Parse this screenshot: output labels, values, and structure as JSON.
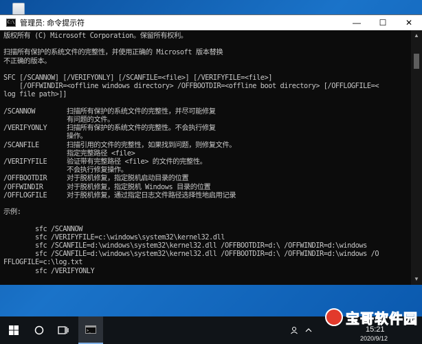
{
  "window": {
    "title": "管理员: 命令提示符",
    "icon_text": "C:\\",
    "minimize": "—",
    "maximize": "☐",
    "close": "✕"
  },
  "console": {
    "lines": [
      "版权所有 (C) Microsoft Corporation。保留所有权利。",
      "",
      "扫描所有保护的系统文件的完整性，并使用正确的 Microsoft 版本替换",
      "不正确的版本。",
      "",
      "SFC [/SCANNOW] [/VERIFYONLY] [/SCANFILE=<file>] [/VERIFYFILE=<file>]",
      "    [/OFFWINDIR=<offline windows directory> /OFFBOOTDIR=<offline boot directory> [/OFFLOGFILE=<",
      "log file path>]]",
      "",
      "/SCANNOW        扫描所有保护的系统文件的完整性，并尽可能修复",
      "                有问题的文件。",
      "/VERIFYONLY     扫描所有保护的系统文件的完整性。不会执行修复",
      "                操作。",
      "/SCANFILE       扫描引用的文件的完整性，如果找到问题，则修复文件。",
      "                指定完整路径 <file>",
      "/VERIFYFILE     验证带有完整路径 <file> 的文件的完整性。",
      "                不会执行修复操作。",
      "/OFFBOOTDIR     对于脱机修复，指定脱机启动目录的位置",
      "/OFFWINDIR      对于脱机修复，指定脱机 Windows 目录的位置",
      "/OFFLOGFILE     对于脱机修复，通过指定日志文件路径选择性地启用记录",
      "",
      "示例:",
      "",
      "        sfc /SCANNOW",
      "        sfc /VERIFYFILE=c:\\windows\\system32\\kernel32.dll",
      "        sfc /SCANFILE=d:\\windows\\system32\\kernel32.dll /OFFBOOTDIR=d:\\ /OFFWINDIR=d:\\windows",
      "        sfc /SCANFILE=d:\\windows\\system32\\kernel32.dll /OFFBOOTDIR=d:\\ /OFFWINDIR=d:\\windows /O",
      "FFLOGFILE=c:\\log.txt",
      "        sfc /VERIFYONLY"
    ]
  },
  "taskbar": {
    "time": "15:21",
    "date": "2020/9/12",
    "watermark": "宝哥软件园"
  },
  "colors": {
    "console_bg": "#0c0c0c",
    "console_text": "#c8c8c8",
    "taskbar_bg": "#101418",
    "watermark": "#e23a2c"
  }
}
